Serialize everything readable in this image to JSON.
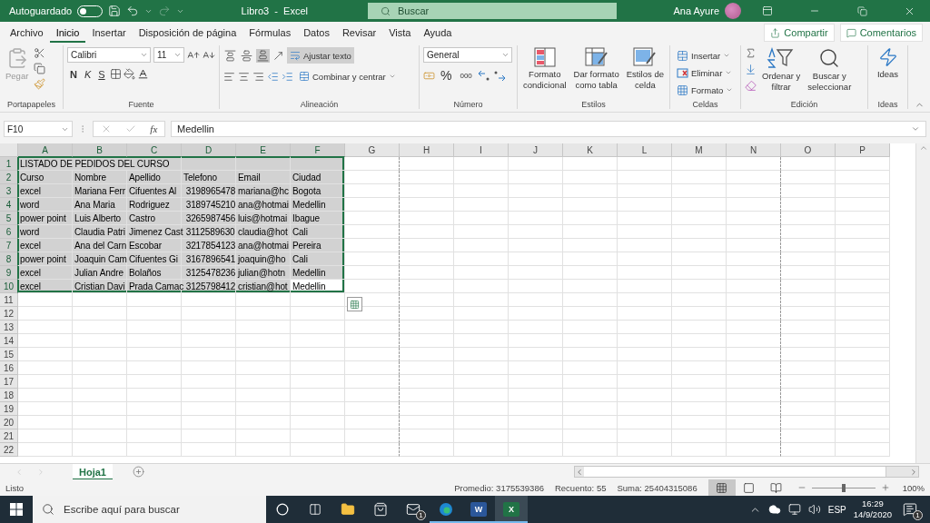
{
  "title_bar": {
    "autosave_label": "Autoguardado",
    "autosave_on": false,
    "title": "Libro3  -  Excel",
    "search_placeholder": "Buscar",
    "user_name": "Ana Ayure",
    "redo_disabled": true
  },
  "menu_tabs": [
    {
      "label": "Archivo",
      "selected": false
    },
    {
      "label": "Inicio",
      "selected": true
    },
    {
      "label": "Insertar",
      "selected": false
    },
    {
      "label": "Disposición de página",
      "selected": false
    },
    {
      "label": "Fórmulas",
      "selected": false
    },
    {
      "label": "Datos",
      "selected": false
    },
    {
      "label": "Revisar",
      "selected": false
    },
    {
      "label": "Vista",
      "selected": false
    },
    {
      "label": "Ayuda",
      "selected": false
    }
  ],
  "share_button": "Compartir",
  "comments_button": "Comentarios",
  "ribbon": {
    "clipboard": {
      "paste_label": "Pegar",
      "group_label": "Portapapeles"
    },
    "font": {
      "font_name": "Calibri",
      "font_size": "11",
      "style_buttons": [
        "N",
        "K",
        "S"
      ],
      "group_label": "Fuente"
    },
    "alignment": {
      "vertical_align": [
        {
          "selected": false
        },
        {
          "selected": false
        },
        {
          "selected": true
        }
      ],
      "wrap_text": {
        "label": "Ajustar texto",
        "selected": true
      },
      "merge_label": "Combinar y centrar",
      "group_label": "Alineación"
    },
    "number": {
      "format": "General",
      "percent": "%",
      "thousands": "000",
      "group_label": "Número"
    },
    "styles": {
      "buttons": [
        {
          "kind": "conditional",
          "lines": [
            "Formato",
            "condicional"
          ]
        },
        {
          "kind": "table",
          "lines": [
            "Dar formato",
            "como tabla"
          ]
        },
        {
          "kind": "cell",
          "lines": [
            "Estilos de",
            "celda"
          ]
        }
      ],
      "group_label": "Estilos"
    },
    "cells": {
      "buttons": [
        {
          "kind": "insert",
          "label": "Insertar"
        },
        {
          "kind": "delete",
          "label": "Eliminar"
        },
        {
          "kind": "format",
          "label": "Formato"
        }
      ],
      "group_label": "Celdas"
    },
    "editing": {
      "buttons": [
        {
          "kind": "sort",
          "lines": [
            "Ordenar y",
            "filtrar"
          ]
        },
        {
          "kind": "find",
          "lines": [
            "Buscar y",
            "seleccionar"
          ]
        }
      ],
      "group_label": "Edición"
    },
    "ideas": {
      "label": "Ideas",
      "group_label": "Ideas"
    }
  },
  "formula_bar": {
    "name_box": "F10",
    "function_label": "fx",
    "value": "Medellin"
  },
  "sheet": {
    "quick_analysis_visible": true,
    "columns": [
      {
        "letter": "A",
        "selected": true,
        "page_break_after": false
      },
      {
        "letter": "B",
        "selected": true,
        "page_break_after": false
      },
      {
        "letter": "C",
        "selected": true,
        "page_break_after": false
      },
      {
        "letter": "D",
        "selected": true,
        "page_break_after": false
      },
      {
        "letter": "E",
        "selected": true,
        "page_break_after": false
      },
      {
        "letter": "F",
        "selected": true,
        "page_break_after": false
      },
      {
        "letter": "G",
        "selected": false,
        "page_break_after": true
      },
      {
        "letter": "H",
        "selected": false,
        "page_break_after": false
      },
      {
        "letter": "I",
        "selected": false,
        "page_break_after": false
      },
      {
        "letter": "J",
        "selected": false,
        "page_break_after": false
      },
      {
        "letter": "K",
        "selected": false,
        "page_break_after": false
      },
      {
        "letter": "L",
        "selected": false,
        "page_break_after": false
      },
      {
        "letter": "M",
        "selected": false,
        "page_break_after": false
      },
      {
        "letter": "N",
        "selected": false,
        "page_break_after": true
      },
      {
        "letter": "O",
        "selected": false,
        "page_break_after": false
      },
      {
        "letter": "P",
        "selected": false,
        "page_break_after": false
      }
    ],
    "rows": [
      {
        "number": "1",
        "selected": true,
        "cells": [
          {
            "text": "LISTADO DE PEDIDOS DEL CURSO",
            "active": false
          }
        ]
      },
      {
        "number": "2",
        "selected": true,
        "cells": [
          {
            "text": "Curso",
            "active": false
          },
          {
            "text": "Nombre",
            "active": false
          },
          {
            "text": "Apellido",
            "active": false
          },
          {
            "text": "Telefono",
            "active": false
          },
          {
            "text": "Email",
            "active": false
          },
          {
            "text": "Ciudad",
            "active": false
          }
        ]
      },
      {
        "number": "3",
        "selected": true,
        "cells": [
          {
            "text": "excel",
            "active": false
          },
          {
            "text": "Mariana Ferr",
            "active": false
          },
          {
            "text": "Cifuentes Al",
            "active": false
          },
          {
            "text": " 3198965478",
            "active": false
          },
          {
            "text": "mariana@hc",
            "active": false
          },
          {
            "text": "Bogota",
            "active": false
          }
        ]
      },
      {
        "number": "4",
        "selected": true,
        "cells": [
          {
            "text": "word",
            "active": false
          },
          {
            "text": "Ana Maria",
            "active": false
          },
          {
            "text": "Rodriguez",
            "active": false
          },
          {
            "text": " 3189745210",
            "active": false
          },
          {
            "text": "ana@hotmai",
            "active": false
          },
          {
            "text": "Medellin",
            "active": false
          }
        ]
      },
      {
        "number": "5",
        "selected": true,
        "cells": [
          {
            "text": "power point",
            "active": false
          },
          {
            "text": "Luis Alberto",
            "active": false
          },
          {
            "text": "Castro",
            "active": false
          },
          {
            "text": " 3265987456",
            "active": false
          },
          {
            "text": "luis@hotmai",
            "active": false
          },
          {
            "text": "Ibague",
            "active": false
          }
        ]
      },
      {
        "number": "6",
        "selected": true,
        "cells": [
          {
            "text": "word",
            "active": false
          },
          {
            "text": "Claudia Patri",
            "active": false
          },
          {
            "text": "Jimenez Cast",
            "active": false
          },
          {
            "text": " 3112589630",
            "active": false
          },
          {
            "text": "claudia@hot",
            "active": false
          },
          {
            "text": "Cali",
            "active": false
          }
        ]
      },
      {
        "number": "7",
        "selected": true,
        "cells": [
          {
            "text": "excel",
            "active": false
          },
          {
            "text": "Ana del Carn",
            "active": false
          },
          {
            "text": "Escobar",
            "active": false
          },
          {
            "text": " 3217854123",
            "active": false
          },
          {
            "text": "ana@hotmai",
            "active": false
          },
          {
            "text": "Pereira",
            "active": false
          }
        ]
      },
      {
        "number": "8",
        "selected": true,
        "cells": [
          {
            "text": "power point",
            "active": false
          },
          {
            "text": "Joaquin Cam",
            "active": false
          },
          {
            "text": "Cifuentes Gi",
            "active": false
          },
          {
            "text": " 3167896541",
            "active": false
          },
          {
            "text": "joaquin@ho",
            "active": false
          },
          {
            "text": "Cali",
            "active": false
          }
        ]
      },
      {
        "number": "9",
        "selected": true,
        "cells": [
          {
            "text": "excel",
            "active": false
          },
          {
            "text": "Julian Andre",
            "active": false
          },
          {
            "text": "Bolaños",
            "active": false
          },
          {
            "text": " 3125478236",
            "active": false
          },
          {
            "text": "julian@hotn",
            "active": false
          },
          {
            "text": "Medellin",
            "active": false
          }
        ]
      },
      {
        "number": "10",
        "selected": true,
        "cells": [
          {
            "text": "excel",
            "active": false
          },
          {
            "text": "Cristian Davi",
            "active": false
          },
          {
            "text": "Prada Camac",
            "active": false
          },
          {
            "text": " 3125798412",
            "active": false
          },
          {
            "text": "cristian@hot",
            "active": false
          },
          {
            "text": "Medellin",
            "active": true
          }
        ]
      },
      {
        "number": "11",
        "selected": false
      },
      {
        "number": "12",
        "selected": false
      },
      {
        "number": "13",
        "selected": false
      },
      {
        "number": "14",
        "selected": false
      },
      {
        "number": "15",
        "selected": false
      },
      {
        "number": "16",
        "selected": false
      },
      {
        "number": "17",
        "selected": false
      },
      {
        "number": "18",
        "selected": false
      },
      {
        "number": "19",
        "selected": false
      },
      {
        "number": "20",
        "selected": false
      },
      {
        "number": "21",
        "selected": false
      },
      {
        "number": "22",
        "selected": false
      }
    ]
  },
  "sheet_tabs": [
    {
      "label": "Hoja1",
      "selected": true
    }
  ],
  "status_bar": {
    "status": "Listo",
    "average": "Promedio: 3175539386",
    "count": "Recuento: 55",
    "sum": "Suma: 25404315086",
    "views": [
      {
        "kind": "normal",
        "selected": true
      },
      {
        "kind": "page_layout",
        "selected": false
      },
      {
        "kind": "page_break",
        "selected": false
      }
    ],
    "zoom": {
      "level": 0.5,
      "reading": "100%"
    }
  },
  "taskbar": {
    "search_placeholder": "Escribe aquí para buscar",
    "apps": [
      {
        "kind": "cortana",
        "running": false,
        "active": false
      },
      {
        "kind": "task_view",
        "running": false,
        "active": false
      },
      {
        "kind": "explorer",
        "running": false,
        "active": false
      },
      {
        "kind": "store",
        "running": false,
        "active": false
      },
      {
        "kind": "mail",
        "running": false,
        "active": false,
        "badge": "1"
      },
      {
        "kind": "edge",
        "running": true,
        "active": false
      },
      {
        "kind": "word",
        "glyph": "W",
        "running": true,
        "active": false
      },
      {
        "kind": "excel",
        "glyph": "X",
        "running": true,
        "active": true
      }
    ],
    "language": "ESP",
    "time": "16:29",
    "date": "14/9/2020",
    "notifications_badge": "1"
  }
}
